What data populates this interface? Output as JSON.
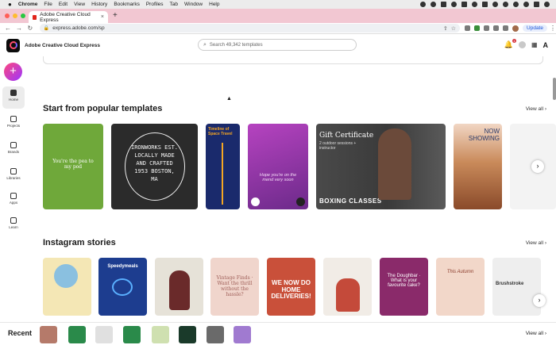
{
  "macos": {
    "app_name": "Chrome",
    "menu": [
      "File",
      "Edit",
      "View",
      "History",
      "Bookmarks",
      "Profiles",
      "Tab",
      "Window",
      "Help"
    ]
  },
  "browser": {
    "tab_title": "Adobe Creative Cloud Express",
    "tab_close": "×",
    "new_tab": "+",
    "url": "express.adobe.com/sp",
    "update_label": "Update"
  },
  "app": {
    "brand": "Adobe Creative Cloud Express",
    "search_placeholder": "Search 49,342 templates",
    "notification_count": "1",
    "adobe_logo": "A"
  },
  "rail": {
    "create_label": "+",
    "items": [
      {
        "label": "Home"
      },
      {
        "label": "Projects"
      },
      {
        "label": "Brands"
      },
      {
        "label": "Libraries"
      },
      {
        "label": "Apps"
      },
      {
        "label": "Learn"
      }
    ]
  },
  "sections": {
    "popular": {
      "title": "Start from popular templates",
      "view_all": "View all  ›",
      "cards": [
        {
          "text": "You're the pea to my pod",
          "bg": "#6fa83a"
        },
        {
          "text": "IRONWORKS EST. LOCALLY MADE AND CRAFTED 1953 BOSTON, MA",
          "bg": "#2b2b2b"
        },
        {
          "text": "Timeline of Space Travel",
          "bg": "#1a2a6c"
        },
        {
          "text": "Hope you're on the mend very soon",
          "bg": "#a83bb0"
        },
        {
          "text": "Gift Certificate",
          "sub": "2 outdoor sessions + instructor",
          "banner": "BOXING CLASSES",
          "bg": "#3a3a3a"
        },
        {
          "text": "NOW SHOWING",
          "bg": "#c98a5a"
        }
      ]
    },
    "instagram": {
      "title": "Instagram stories",
      "view_all": "View all  ›",
      "cards": [
        {
          "text": "",
          "bg": "#f4e7b5"
        },
        {
          "text": "Speedymeals",
          "bg": "#1d3d8f"
        },
        {
          "text": "",
          "bg": "#e6e2d8"
        },
        {
          "text": "Vintage Finds · Want the thrill without the hassle?",
          "bg": "#f0d5cc"
        },
        {
          "text": "WE NOW DO HOME DELIVERIES!",
          "bg": "#c9503a"
        },
        {
          "text": "",
          "bg": "#f1ece6"
        },
        {
          "text": "The Doughbar · What is your favourite cake?",
          "bg": "#8a2a6a"
        },
        {
          "text": "This Autumn",
          "bg": "#f2d7c9"
        },
        {
          "text": "Brushstroke",
          "bg": "#eeeeee"
        }
      ]
    }
  },
  "recent": {
    "label": "Recent",
    "view_all": "View all  ›"
  }
}
